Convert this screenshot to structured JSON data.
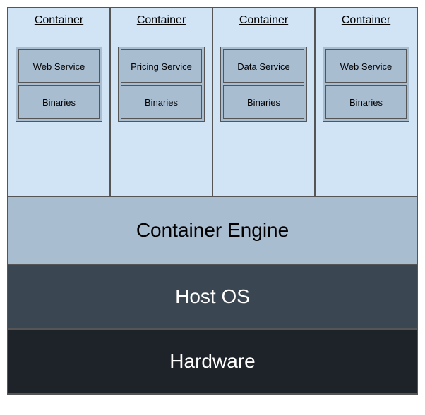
{
  "containers": [
    {
      "title": "Container",
      "service": "Web Service",
      "binaries": "Binaries"
    },
    {
      "title": "Container",
      "service": "Pricing Service",
      "binaries": "Binaries"
    },
    {
      "title": "Container",
      "service": "Data Service",
      "binaries": "Binaries"
    },
    {
      "title": "Container",
      "service": "Web Service",
      "binaries": "Binaries"
    }
  ],
  "layers": {
    "engine": "Container Engine",
    "host": "Host OS",
    "hardware": "Hardware"
  }
}
